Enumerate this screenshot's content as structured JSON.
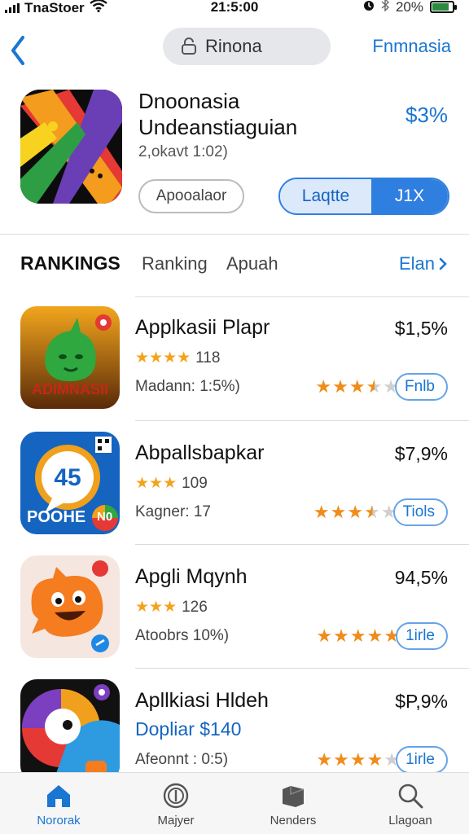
{
  "status_bar": {
    "carrier": "TnaStoer",
    "time": "21:5:00",
    "battery_text": "20%",
    "battery_level": 0.85
  },
  "nav": {
    "search_text": "Rinona",
    "right_link": "Fnmnasia"
  },
  "featured": {
    "title_line1": "Dnoonasia",
    "title_line2": "Undeanstiaguian",
    "subtitle": "2,okavt 1:02)",
    "price": "$3%",
    "outline_button": "Apooalaor",
    "primary_button": "Laqtte",
    "secondary_button": "J1X"
  },
  "tabs": {
    "main": "RANKINGS",
    "items": [
      "Ranking",
      "Apuah"
    ],
    "more": "Elan"
  },
  "apps": [
    {
      "name": "Applkasii Plapr",
      "price": "$1,5%",
      "stars_text": "★★★★",
      "count": "118",
      "meta": "Madann: 1:5%)",
      "rating": 3.5,
      "rating_button": "Fnlb",
      "icon_text": "ADIMNASII",
      "icon": "green-creature-icon",
      "icon_colors": [
        "#e89a1c",
        "#5a2a08",
        "#2fa83f"
      ]
    },
    {
      "name": "Abpallsbapkar",
      "price": "$7,9%",
      "stars_text": "★★★",
      "count": "109",
      "meta": "Kagner: 17",
      "rating": 3.5,
      "rating_button": "Tiols",
      "icon_text": "POOHE",
      "icon_badge": "N0",
      "icon": "chat-bubble-icon",
      "icon_colors": [
        "#1564c0",
        "#f0a01c",
        "#e53935"
      ]
    },
    {
      "name": "Apgli Mqynh",
      "price": "94,5%",
      "stars_text": "★★★",
      "count": "126",
      "meta": "Atoobrs 10%)",
      "rating": 5,
      "rating_button": "1irle",
      "icon": "smiley-blob-icon",
      "icon_colors": [
        "#f5e6e0",
        "#f57c1f",
        "#e53935"
      ]
    },
    {
      "name": "Apllkiasi Hldeh",
      "price": "$P,9%",
      "promo": "Dopliar $140",
      "meta": "Afeonnt : 0:5)",
      "rating": 4,
      "rating_button": "1irle",
      "icon": "colorful-bird-icon",
      "icon_colors": [
        "#111111",
        "#e53935",
        "#2e9be0"
      ]
    }
  ],
  "bottom_nav": [
    "Nororak",
    "Majyer",
    "Nenders",
    "Llagoan"
  ],
  "colors": {
    "accent": "#1976d2",
    "star": "#f08c1a"
  }
}
